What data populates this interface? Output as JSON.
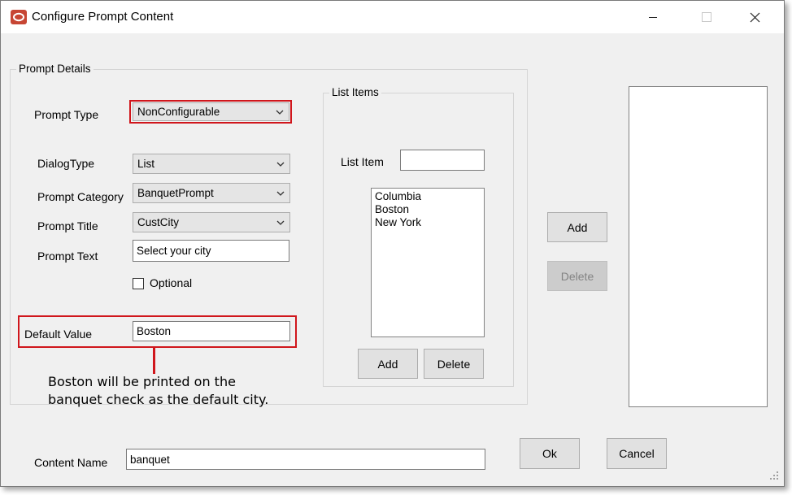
{
  "window": {
    "title": "Configure Prompt Content",
    "accent": "#c74634"
  },
  "prompt_details": {
    "legend": "Prompt Details",
    "prompt_type_label": "Prompt Type",
    "prompt_type_value": "NonConfigurable",
    "dialog_type_label": "DialogType",
    "dialog_type_value": "List",
    "prompt_category_label": "Prompt Category",
    "prompt_category_value": "BanquetPrompt",
    "prompt_title_label": "Prompt Title",
    "prompt_title_value": "CustCity",
    "prompt_text_label": "Prompt Text",
    "prompt_text_value": "Select your city",
    "optional_label": "Optional",
    "optional_checked": false,
    "default_value_label": "Default Value",
    "default_value_value": "Boston"
  },
  "list_items": {
    "legend": "List Items",
    "list_item_label": "List Item",
    "list_item_value": "",
    "items": [
      "Columbia",
      "Boston",
      "New York"
    ],
    "add_label": "Add",
    "delete_label": "Delete"
  },
  "right_panel": {
    "add_label": "Add",
    "delete_label": "Delete"
  },
  "annotation": {
    "line1": "Boston will be printed on the",
    "line2": "banquet check as the default city.",
    "highlight_color": "#d0161c"
  },
  "footer": {
    "content_name_label": "Content Name",
    "content_name_value": "banquet",
    "ok_label": "Ok",
    "cancel_label": "Cancel"
  }
}
